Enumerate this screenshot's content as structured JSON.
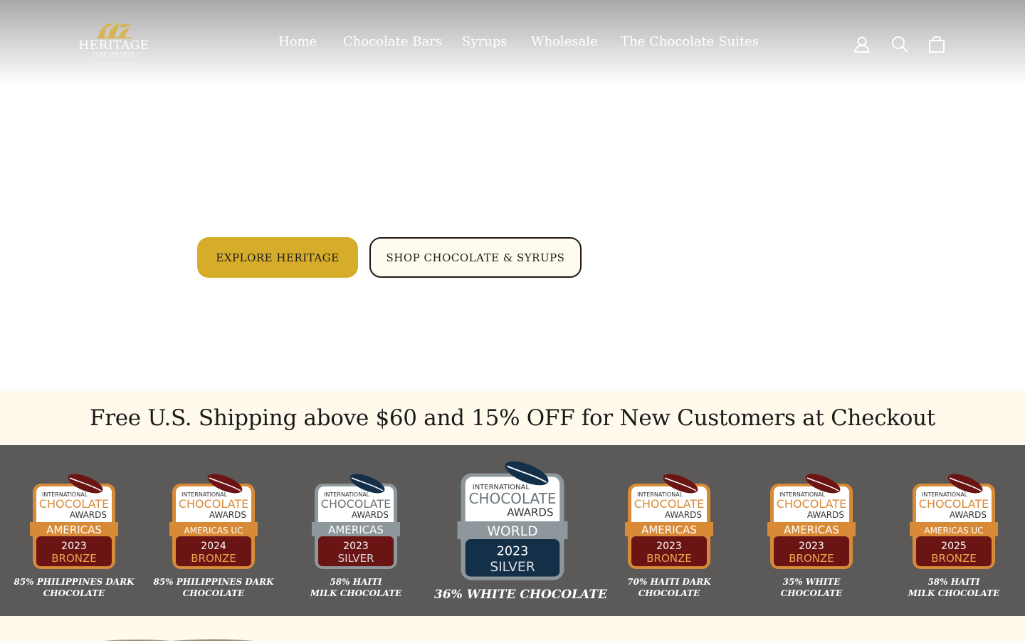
{
  "brand": {
    "name": "HERITAGE",
    "tagline": "• FOOD CRAFTERS •"
  },
  "nav": {
    "items": [
      "Home",
      "Chocolate Bars",
      "Syrups",
      "Wholesale",
      "The Chocolate Suites"
    ],
    "icons": [
      "account-icon",
      "search-icon",
      "cart-icon"
    ]
  },
  "hero": {
    "primary_button": "EXPLORE HERITAGE",
    "secondary_button": "SHOP CHOCOLATE & SYRUPS"
  },
  "promo": {
    "text": "Free U.S. Shipping above $60 and 15% OFF for New Customers at Checkout"
  },
  "awards": [
    {
      "line1": "INTERNATIONAL",
      "line2": "CHOCOLATE",
      "line3": "AWARDS",
      "region": "AMERICAS",
      "year": "2023",
      "medal": "BRONZE",
      "caption": [
        "85% PHILIPPINES  DARK",
        "CHOCOLATE"
      ]
    },
    {
      "line1": "INTERNATIONAL",
      "line2": "CHOCOLATE",
      "line3": "AWARDS",
      "region": "AMERICAS UC",
      "year": "2024",
      "medal": "BRONZE",
      "caption": [
        "85% PHILIPPINES  DARK",
        "CHOCOLATE"
      ]
    },
    {
      "line1": "INTERNATIONAL",
      "line2": "CHOCOLATE",
      "line3": "AWARDS",
      "region": "AMERICAS",
      "year": "2023",
      "medal": "SILVER",
      "caption": [
        "58% HAITI",
        "MILK CHOCOLATE"
      ]
    },
    {
      "line1": "INTERNATIONAL",
      "line2": "CHOCOLATE",
      "line3": "AWARDS",
      "region": "WORLD",
      "year": "2023",
      "medal": "SILVER",
      "caption": [
        "36% WHITE CHOCOLATE"
      ]
    },
    {
      "line1": "INTERNATIONAL",
      "line2": "CHOCOLATE",
      "line3": "AWARDS",
      "region": "AMERICAS",
      "year": "2023",
      "medal": "BRONZE",
      "caption": [
        "70% HAITI  DARK",
        "CHOCOLATE"
      ]
    },
    {
      "line1": "INTERNATIONAL",
      "line2": "CHOCOLATE",
      "line3": "AWARDS",
      "region": "AMERICAS",
      "year": "2023",
      "medal": "BRONZE",
      "caption": [
        "35% WHITE",
        "CHOCOLATE"
      ]
    },
    {
      "line1": "INTERNATIONAL",
      "line2": "CHOCOLATE",
      "line3": "AWARDS",
      "region": "AMERICAS UC",
      "year": "2025",
      "medal": "BRONZE",
      "caption": [
        "58% HAITI",
        "MILK CHOCOLATE"
      ]
    }
  ],
  "colors": {
    "gold": "#d6ad2a",
    "cream": "#fffaec",
    "band": "#5b5a59",
    "bronze_frame": "#d88a37",
    "silver_frame": "#8e979c",
    "maroon": "#6b1414",
    "navy": "#143049"
  }
}
